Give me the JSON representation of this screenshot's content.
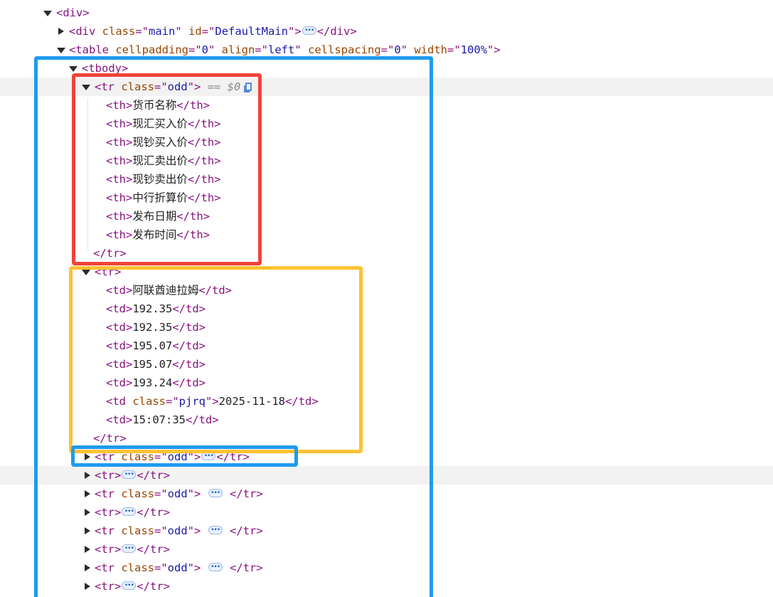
{
  "dom": {
    "div_open": "<div>",
    "main_div": {
      "open": "<div ",
      "class_attr": "class",
      "eq1": "=\"",
      "class_val": "main",
      "q1": "\" ",
      "id_attr": "id",
      "eq2": "=\"",
      "id_val": "DefaultMain",
      "q2": "\">",
      "close": "</div>"
    },
    "table": {
      "open": "<table ",
      "a1": "cellpadding",
      "v1": "0",
      "a2": "align",
      "v2": "left",
      "a3": "cellspacing",
      "v3": "0",
      "a4": "width",
      "v4": "100%"
    },
    "tbody_open": "<tbody>",
    "header_row": {
      "tr_class": "odd",
      "selection_marker": "== $0",
      "headers": [
        "货币名称",
        "现汇买入价",
        "现钞买入价",
        "现汇卖出价",
        "现钞卖出价",
        "中行折算价",
        "发布日期",
        "发布时间"
      ]
    },
    "data_row": {
      "cells": [
        "阿联酋迪拉姆",
        "192.35",
        "192.35",
        "195.07",
        "195.07",
        "193.24",
        "2025-11-18",
        "15:07:35"
      ],
      "date_cell_class": "pjrq"
    },
    "collapsed_rows": [
      {
        "has_class": true,
        "class": "odd"
      },
      {
        "has_class": false
      },
      {
        "has_class": true,
        "class": "odd"
      },
      {
        "has_class": false
      },
      {
        "has_class": true,
        "class": "odd"
      },
      {
        "has_class": false
      },
      {
        "has_class": true,
        "class": "odd"
      },
      {
        "has_class": false
      }
    ],
    "tr_close": "</tr>"
  },
  "colors": {
    "tag": "#881280",
    "attr_name": "#994500",
    "attr_value": "#1a1aa6",
    "highlight_red": "#f0433a",
    "highlight_yellow": "#ffc233",
    "highlight_blue": "#1e9bf0"
  }
}
